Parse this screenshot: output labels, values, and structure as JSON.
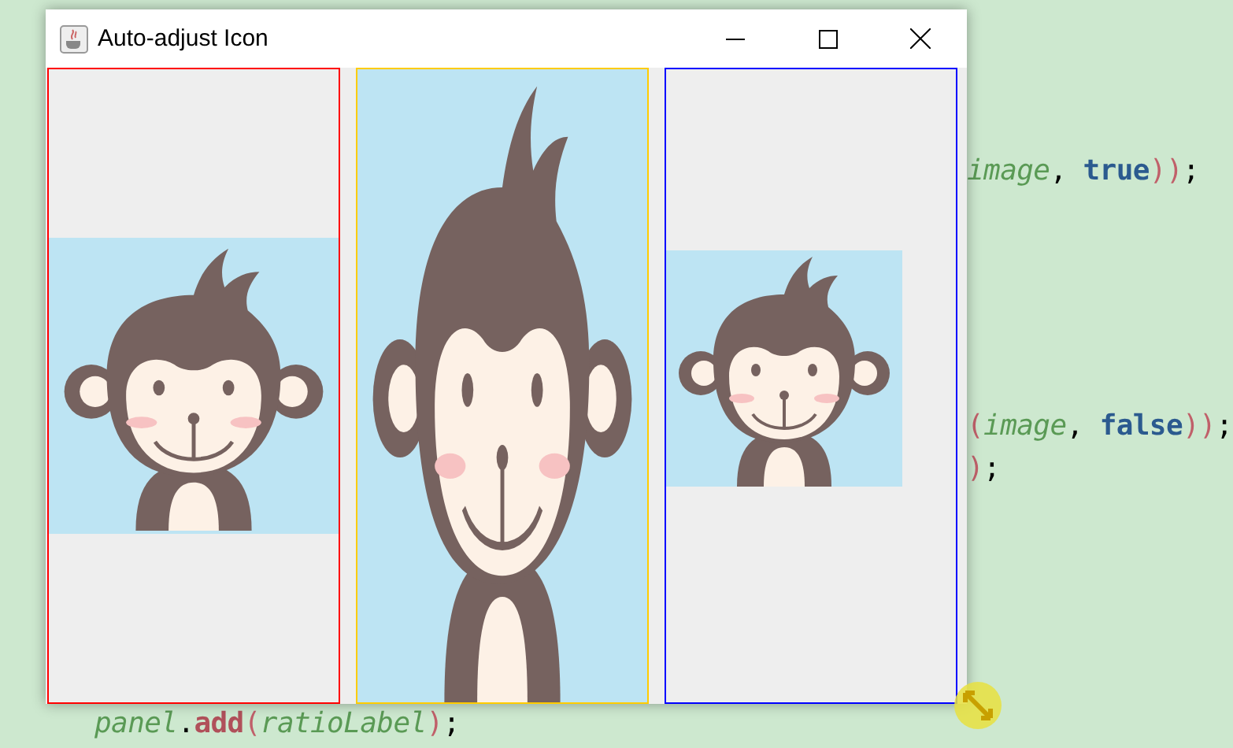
{
  "editor": {
    "lines": [
      {
        "segments": [
          {
            "kind": "var",
            "text": "image"
          },
          {
            "kind": "punct",
            "text": ", "
          },
          {
            "kind": "keyword",
            "text": "true"
          },
          {
            "kind": "paren",
            "text": "))"
          },
          {
            "kind": "punct",
            "text": ";"
          }
        ]
      },
      {
        "segments": [
          {
            "kind": "paren",
            "text": "("
          },
          {
            "kind": "var",
            "text": "image"
          },
          {
            "kind": "punct",
            "text": ", "
          },
          {
            "kind": "keyword",
            "text": "false"
          },
          {
            "kind": "paren",
            "text": "))"
          },
          {
            "kind": "punct",
            "text": ";"
          }
        ]
      },
      {
        "segments": [
          {
            "kind": "paren",
            "text": ")"
          },
          {
            "kind": "punct",
            "text": ";"
          }
        ]
      },
      {
        "segments": [
          {
            "kind": "var",
            "text": "panel"
          },
          {
            "kind": "punct",
            "text": "."
          },
          {
            "kind": "method",
            "text": "add"
          },
          {
            "kind": "paren",
            "text": "("
          },
          {
            "kind": "var",
            "text": "ratioLabel"
          },
          {
            "kind": "paren",
            "text": ")"
          },
          {
            "kind": "punct",
            "text": ";"
          }
        ]
      }
    ]
  },
  "window": {
    "title": "Auto-adjust Icon",
    "panels": [
      {
        "kind": "fit-width",
        "color": "#ff0000"
      },
      {
        "kind": "stretch",
        "color": "#ffcc00"
      },
      {
        "kind": "original",
        "color": "#0000ff"
      }
    ]
  }
}
